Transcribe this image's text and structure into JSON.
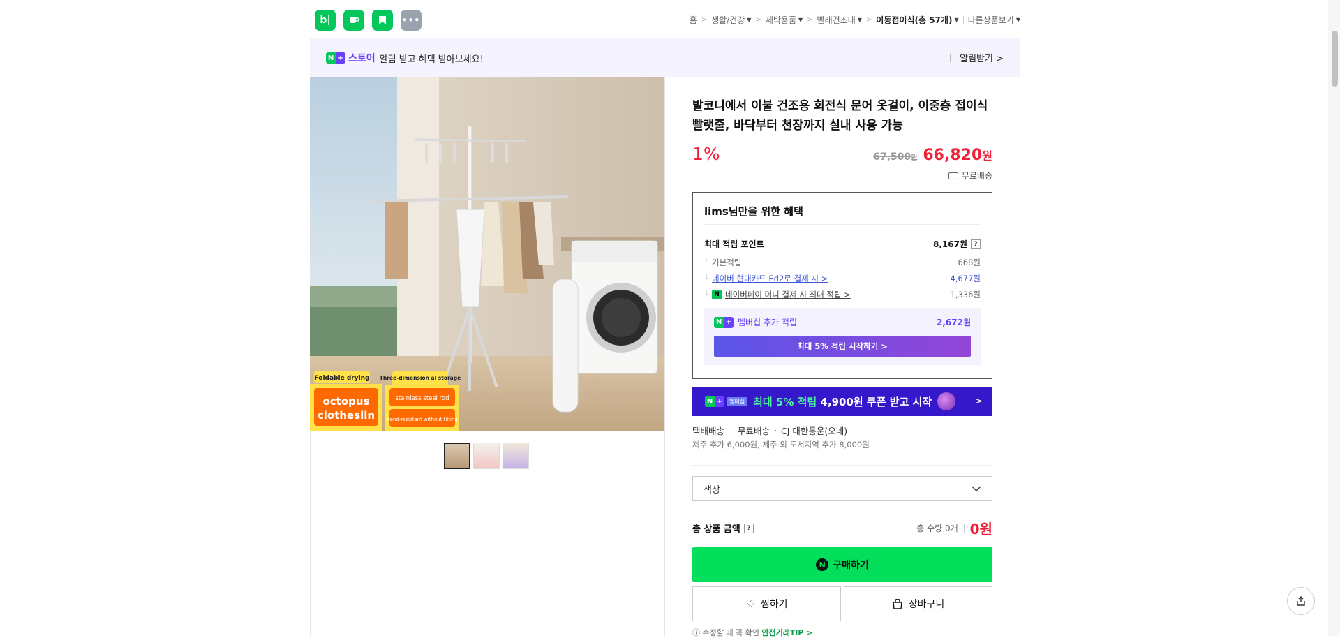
{
  "header": {
    "app_icons": [
      {
        "name": "blog-app-icon",
        "label": "b|"
      },
      {
        "name": "cafe-app-icon",
        "label": "☕"
      },
      {
        "name": "bookmark-app-icon",
        "label": "🔖"
      },
      {
        "name": "more-apps-icon",
        "label": "•••"
      }
    ],
    "breadcrumb": [
      {
        "label": "홈",
        "caret": false
      },
      {
        "label": "생활/건강",
        "caret": true
      },
      {
        "label": "세탁용품",
        "caret": true
      },
      {
        "label": "빨래건조대",
        "caret": true
      },
      {
        "label": "이동접이식(총 57개)",
        "caret": true,
        "current": true
      }
    ],
    "other_products": "다른상품보기"
  },
  "store_banner": {
    "store_name": "스토어",
    "message": "알림 받고 혜택 받아보세요!",
    "alert_button": "알림받기 >"
  },
  "product": {
    "title": "발코니에서 이불 건조용 회전식 문어 옷걸이, 이중층 접이식 빨랫줄, 바닥부터 천장까지 실내 사용 가능",
    "discount": "1%",
    "original_price": "67,500",
    "original_unit": "원",
    "sale_price": "66,820",
    "sale_unit": "원",
    "shipping_badge": "무료배송",
    "image_labels": {
      "tag1": "Foldable drying",
      "tag2": "Three-dimension al storage",
      "brand1": "octopus",
      "brand2": "clotheslin",
      "feat1": "stainless steel rod",
      "feat2": "bend-resistant without tilting"
    }
  },
  "benefits": {
    "heading": "lims님만을 위한 혜택",
    "max_points_label": "최대 적립 포인트",
    "max_points_value": "8,167원",
    "rows": [
      {
        "label": "기본적립",
        "value": "668원",
        "style": "plain"
      },
      {
        "label": "네이버 현대카드 Ed2로 결제 시 >",
        "value": "4,677원",
        "style": "link"
      },
      {
        "label": "네이버페이 머니 결제 시 최대 적립 >",
        "value": "1,336원",
        "style": "npay"
      }
    ],
    "membership_label": "멤버십 추가 적립",
    "membership_value": "2,672원",
    "membership_button": "최대 5% 적립 시작하기 >"
  },
  "promo": {
    "chip": "멤버십",
    "text_green": "최대 5% 적립",
    "text_white": "4,900원 쿠폰 받고 시작",
    "arrow": ">"
  },
  "shipping": {
    "type": "택배배송",
    "fee": "무료배송",
    "carrier": "CJ 대한통운(오네)",
    "extra": "제주 추가 6,000원, 제주 외 도서지역 추가 8,000원"
  },
  "option": {
    "placeholder": "색상"
  },
  "total": {
    "label": "총 상품 금액",
    "qty": "총 수량 0개",
    "price": "0원"
  },
  "actions": {
    "buy": "구매하기",
    "wish": "찜하기",
    "cart": "장바구니"
  },
  "safe_tip": {
    "prefix": "ⓘ 수정할 때 꼭 확인",
    "highlight": "안전거래TIP >"
  },
  "colors": {
    "naver_green": "#03c75a",
    "buy_green": "#03de5b",
    "price_red": "#f0213a",
    "membership_purple": "#6841ff"
  }
}
